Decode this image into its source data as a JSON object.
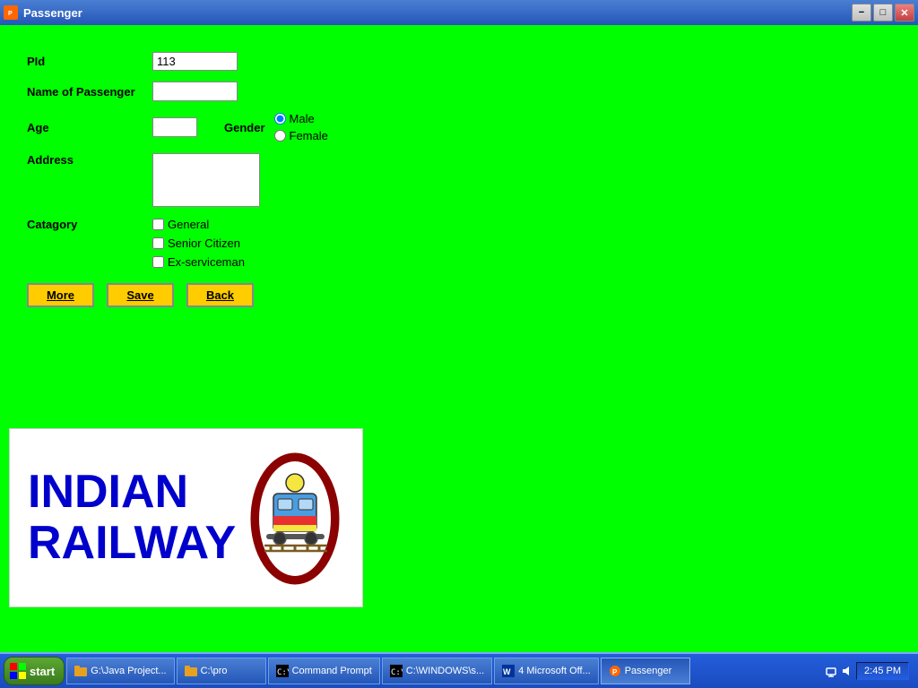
{
  "window": {
    "title": "Passenger",
    "icon": "passenger-icon"
  },
  "form": {
    "pid_label": "PId",
    "pid_value": "113",
    "name_label": "Name of Passenger",
    "name_value": "",
    "age_label": "Age",
    "age_value": "",
    "gender_label": "Gender",
    "gender_options": [
      {
        "label": "Male",
        "value": "male",
        "selected": true
      },
      {
        "label": "Female",
        "value": "female",
        "selected": false
      }
    ],
    "address_label": "Address",
    "address_value": "",
    "category_label": "Catagory",
    "category_options": [
      {
        "label": "General",
        "checked": false
      },
      {
        "label": "Senior Citizen",
        "checked": false
      },
      {
        "label": "Ex-serviceman",
        "checked": false
      }
    ]
  },
  "buttons": {
    "more_label": "More",
    "more_underline": "M",
    "save_label": "Save",
    "save_underline": "S",
    "back_label": "Back",
    "back_underline": "B"
  },
  "banner": {
    "line1": "INDIAN",
    "line2": "RAILWAY"
  },
  "taskbar": {
    "start_label": "start",
    "time": "2:45 PM",
    "items": [
      {
        "label": "G:\\Java Project...",
        "icon": "folder-icon"
      },
      {
        "label": "C:\\pro",
        "icon": "folder-icon"
      },
      {
        "label": "Command Prompt",
        "icon": "cmd-icon"
      },
      {
        "label": "C:\\WINDOWS\\s...",
        "icon": "cmd-icon"
      },
      {
        "label": "4 Microsoft Off...",
        "icon": "word-icon"
      },
      {
        "label": "Passenger",
        "icon": "passenger-icon"
      }
    ]
  }
}
